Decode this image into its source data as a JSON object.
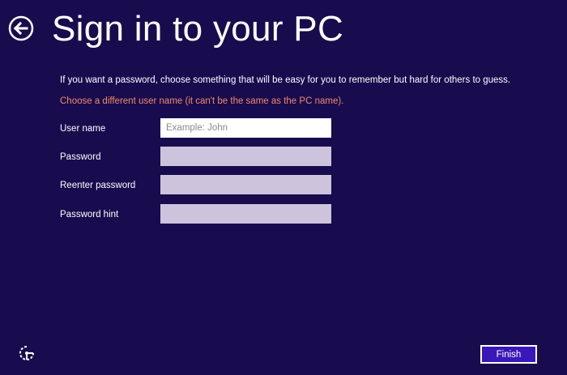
{
  "header": {
    "title": "Sign in to your PC"
  },
  "form": {
    "instructions": "If you want a password, choose something that will be easy for you to remember but hard for others to guess.",
    "error": "Choose a different user name (it can't be the same as the PC name).",
    "fields": [
      {
        "label": "User name",
        "value": "",
        "placeholder": "Example: John"
      },
      {
        "label": "Password",
        "value": "",
        "placeholder": ""
      },
      {
        "label": "Reenter password",
        "value": "",
        "placeholder": ""
      },
      {
        "label": "Password hint",
        "value": "",
        "placeholder": ""
      }
    ]
  },
  "footer": {
    "finish_label": "Finish",
    "ease_of_access_icon": "ease-of-access-icon"
  },
  "colors": {
    "background": "#180c4e",
    "error_text": "#f08a6a",
    "button_fill": "#3a18b8",
    "inactive_field": "#cdc3dc"
  }
}
